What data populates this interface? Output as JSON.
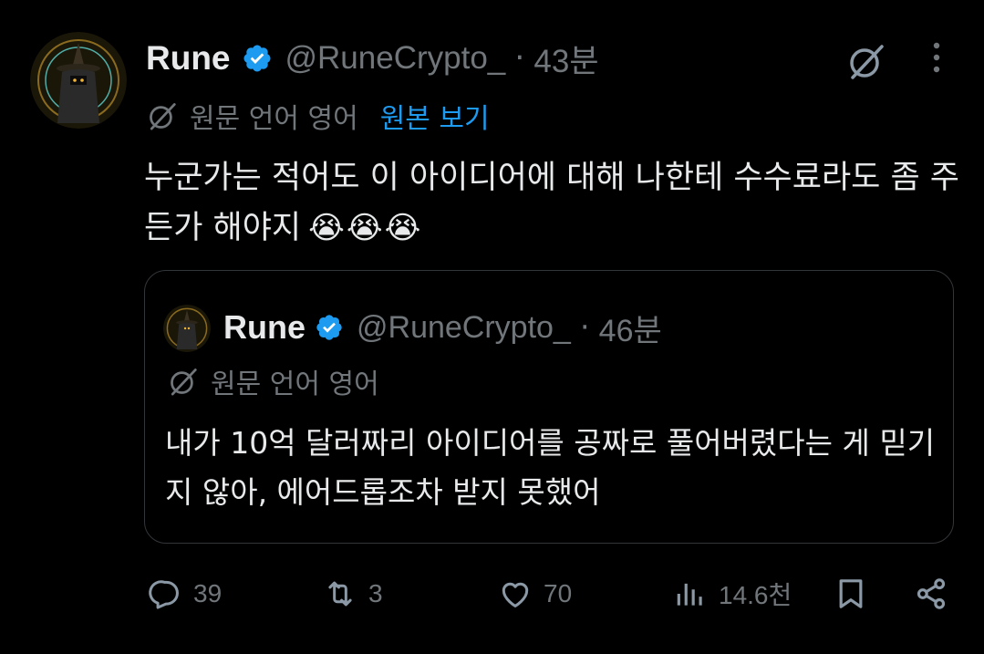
{
  "tweet": {
    "name": "Rune",
    "handle": "@RuneCrypto_",
    "separator": "·",
    "time": "43분",
    "translation": {
      "label": "원문 언어 영어",
      "link": "원본 보기"
    },
    "text": "누군가는 적어도 이 아이디어에 대해 나한테 수수료라도 좀 주든가 해야지",
    "emojis": "😭😭😭"
  },
  "quote": {
    "name": "Rune",
    "handle": "@RuneCrypto_",
    "separator": "·",
    "time": "46분",
    "translation": {
      "label": "원문 언어 영어"
    },
    "text": "내가 10억 달러짜리 아이디어를 공짜로 풀어버렸다는 게 믿기지 않아, 에어드롭조차 받지 못했어"
  },
  "actions": {
    "replies": "39",
    "reposts": "3",
    "likes": "70",
    "views": "14.6천"
  },
  "colors": {
    "background": "#000000",
    "text": "#e7e9ea",
    "muted": "#71767b",
    "link": "#1d9bf0",
    "verified": "#1d9bf0"
  },
  "icons": [
    "grok-icon",
    "more-icon",
    "verified-badge-icon",
    "translate-icon",
    "reply-icon",
    "repost-icon",
    "like-icon",
    "views-icon",
    "bookmark-icon",
    "share-icon"
  ]
}
